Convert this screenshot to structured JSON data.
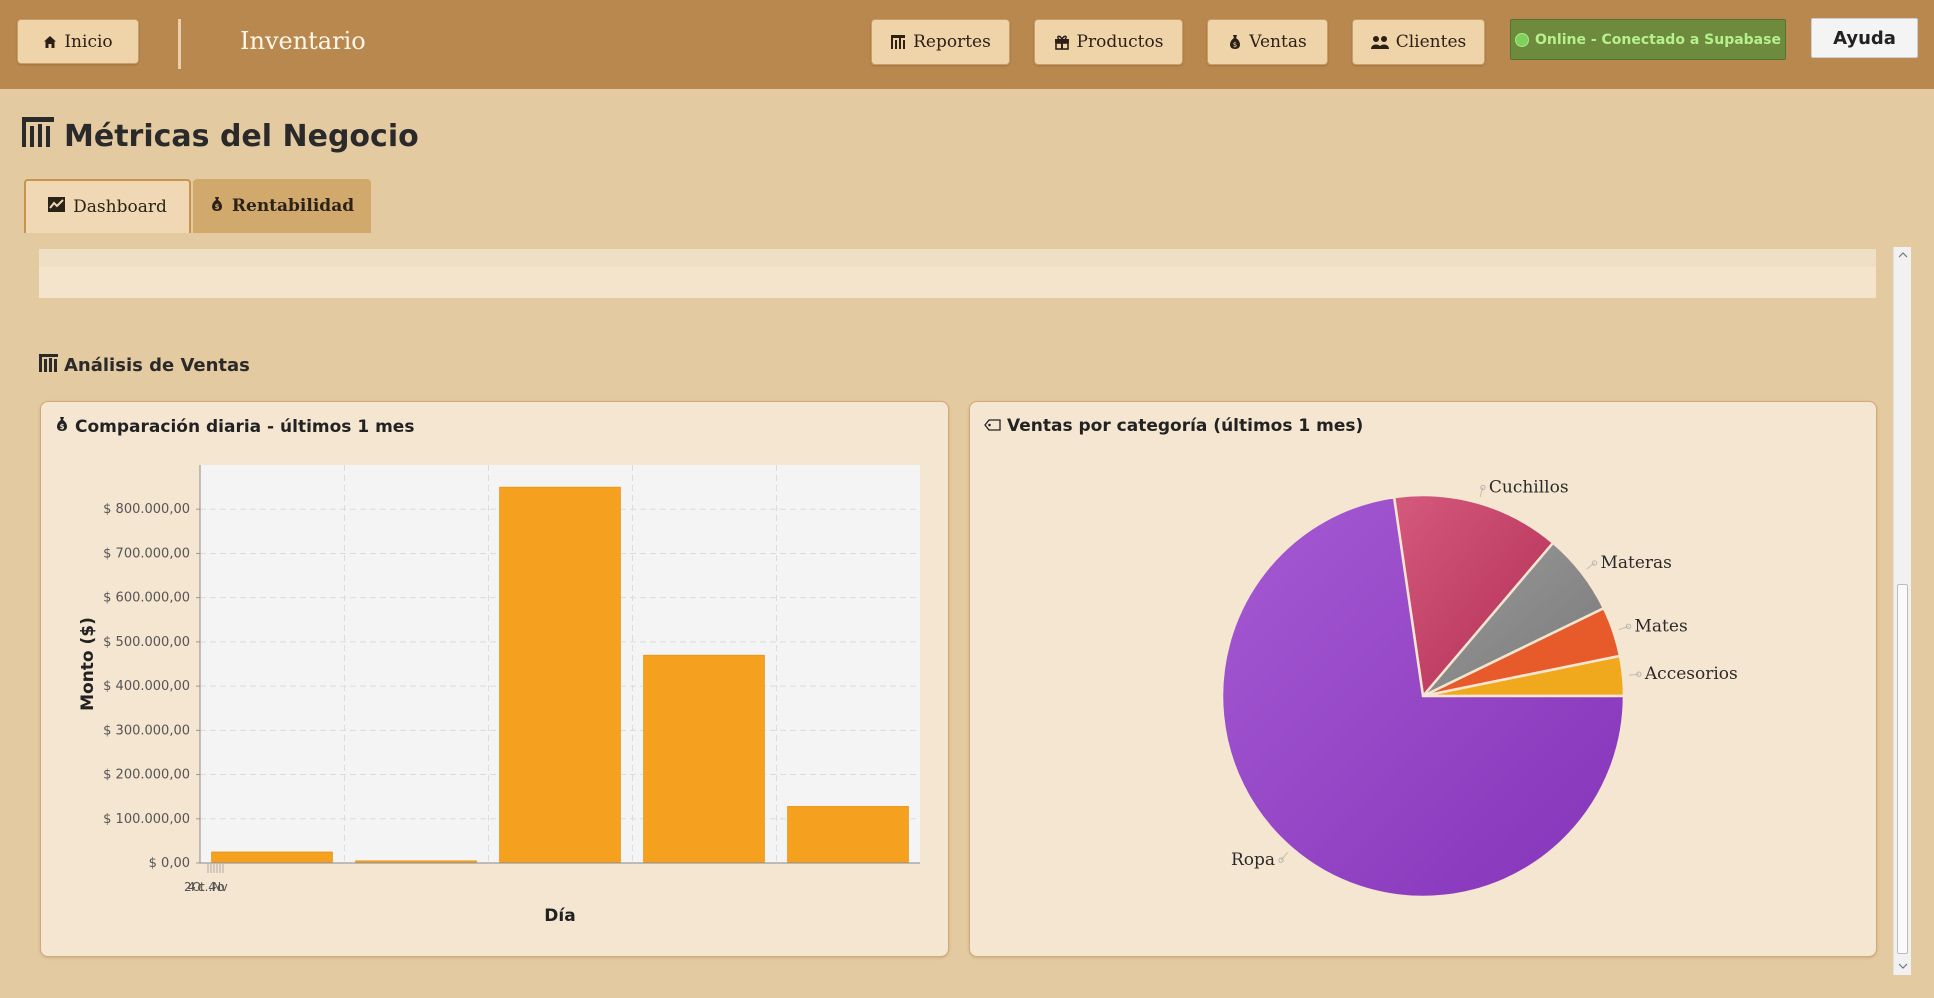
{
  "topbar": {
    "home_label": "Inicio",
    "app_title": "Inventario",
    "nav": [
      {
        "label": "Reportes",
        "icon": "bar-chart-icon"
      },
      {
        "label": "Productos",
        "icon": "gift-icon"
      },
      {
        "label": "Ventas",
        "icon": "money-bag-icon"
      },
      {
        "label": "Clientes",
        "icon": "users-icon"
      }
    ],
    "status_label": "Online - Conectado a Supabase",
    "help_label": "Ayuda"
  },
  "page": {
    "title": "Métricas del Negocio",
    "tabs": [
      {
        "label": "Dashboard",
        "icon": "line-chart-icon",
        "active": true
      },
      {
        "label": "Rentabilidad",
        "icon": "money-bag-icon",
        "active": false
      }
    ]
  },
  "section": {
    "title": "Análisis de Ventas"
  },
  "cards": {
    "bar_title": "Comparación diaria - últimos 1 mes",
    "pie_title": "Ventas por categoría (últimos 1 mes)"
  },
  "colors": {
    "topbar": "#b8884f",
    "background": "#e4caa0",
    "card": "#f5e6d1",
    "bar": "#f5a11f",
    "status_bg": "#6d8a3d",
    "status_text": "#b6f08f"
  },
  "chart_data": [
    {
      "type": "bar",
      "title": "Comparación diaria - últimos 1 mes",
      "xlabel": "Día",
      "ylabel": "Monto ($)",
      "ylim": [
        0,
        900000
      ],
      "yticks": [
        0,
        100000,
        200000,
        300000,
        400000,
        500000,
        600000,
        700000,
        800000
      ],
      "ytick_labels": [
        "$ 0,00",
        "$ 100.000,00",
        "$ 200.000,00",
        "$ 300.000,00",
        "$ 400.000,00",
        "$ 500.000,00",
        "$ 600.000,00",
        "$ 700.000,00",
        "$ 800.000,00"
      ],
      "x_tick_label": "24-Oct … 4-Nov",
      "values": [
        25000,
        5000,
        850000,
        470000,
        128000
      ],
      "bar_color": "#f5a11f",
      "grid": true
    },
    {
      "type": "pie",
      "title": "Ventas por categoría (últimos 1 mes)",
      "labels": [
        "Accesorios",
        "Mates",
        "Materas",
        "Cuchillos",
        "Ropa"
      ],
      "values": [
        3.2,
        4.0,
        6.6,
        13.5,
        72.7
      ],
      "colors": [
        "#f0a81c",
        "#e75a2a",
        "#8c8c8c",
        "#c23d63",
        "#9340c3"
      ]
    }
  ]
}
